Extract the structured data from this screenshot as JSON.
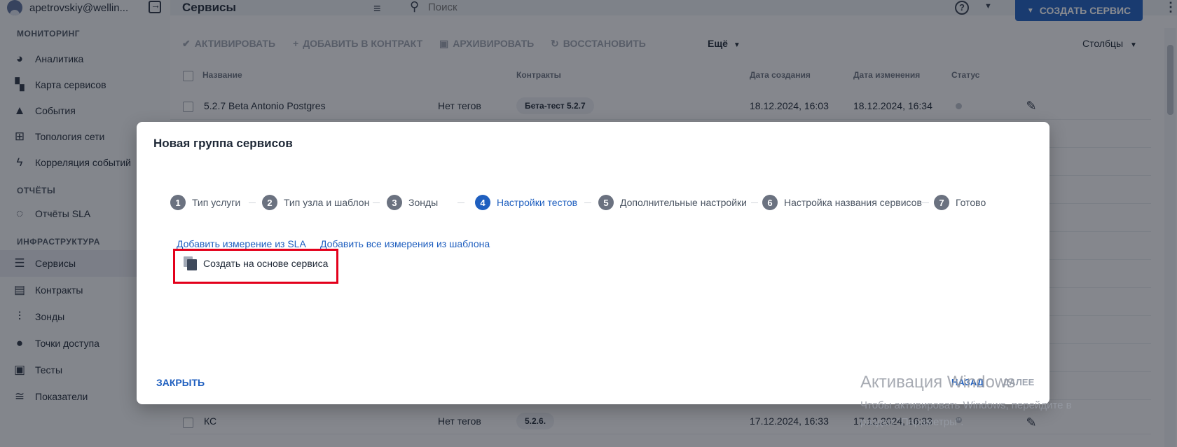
{
  "user": {
    "name": "apetrovskiy@wellin..."
  },
  "sidebar": {
    "sections": [
      {
        "title": "МОНИТОРИНГ"
      },
      {
        "title": "ОТЧЁТЫ"
      },
      {
        "title": "ИНФРАСТРУКТУРА"
      }
    ],
    "items": [
      {
        "label": "Аналитика",
        "icon": "pie-chart-icon"
      },
      {
        "label": "Карта сервисов",
        "icon": "map-icon"
      },
      {
        "label": "События",
        "icon": "warning-icon"
      },
      {
        "label": "Топология сети",
        "icon": "topology-icon"
      },
      {
        "label": "Корреляция событий",
        "icon": "bolt-icon"
      },
      {
        "label": "Отчёты SLA",
        "icon": "refresh-icon"
      },
      {
        "label": "Сервисы",
        "icon": "list-icon"
      },
      {
        "label": "Контракты",
        "icon": "document-icon"
      },
      {
        "label": "Зонды",
        "icon": "probe-icon"
      },
      {
        "label": "Точки доступа",
        "icon": "circle-icon"
      },
      {
        "label": "Тесты",
        "icon": "tests-icon"
      },
      {
        "label": "Показатели",
        "icon": "metrics-icon"
      }
    ]
  },
  "header": {
    "title": "Сервисы",
    "search_placeholder": "Поиск",
    "help": "?",
    "create_button": "СОЗДАТЬ СЕРВИС"
  },
  "toolbar": {
    "activate": "АКТИВИРОВАТЬ",
    "add_to_contract": "ДОБАВИТЬ В КОНТРАКТ",
    "archive": "АРХИВИРОВАТЬ",
    "restore": "ВОССТАНОВИТЬ",
    "more": "Ещё",
    "columns": "Столбцы"
  },
  "table": {
    "columns": [
      "Название",
      "Контракты",
      "Дата создания",
      "Дата изменения",
      "Статус"
    ],
    "rows": [
      {
        "name": "5.2.7 Beta Antonio Postgres",
        "tags": "Нет тегов",
        "contract": "Бета-тест 5.2.7",
        "created": "18.12.2024, 16:03",
        "modified": "18.12.2024, 16:34"
      },
      {
        "name": "КС",
        "tags": "Нет тегов",
        "contract": "5.2.6.",
        "created": "17.12.2024, 16:33",
        "modified": "17.12.2024, 16:33"
      }
    ]
  },
  "modal": {
    "title": "Новая группа сервисов",
    "steps": [
      {
        "num": "1",
        "label": "Тип услуги"
      },
      {
        "num": "2",
        "label": "Тип узла и шаблон"
      },
      {
        "num": "3",
        "label": "Зонды"
      },
      {
        "num": "4",
        "label": "Настройки тестов"
      },
      {
        "num": "5",
        "label": "Дополнительные настройки"
      },
      {
        "num": "6",
        "label": "Настройка названия сервисов"
      },
      {
        "num": "7",
        "label": "Готово"
      }
    ],
    "active_step": 4,
    "link_add_sla": "Добавить измерение из SLA",
    "link_add_all": "Добавить все измерения из шаблона",
    "based_on_service": "Создать на основе сервиса",
    "close": "ЗАКРЫТЬ",
    "back": "НАЗАД",
    "next": "ДАЛЕЕ"
  },
  "watermark": {
    "title": "Активация Windows",
    "line1": "Чтобы активировать Windows, перейдите в",
    "line2": "раздел \"Параметры\"."
  },
  "colors": {
    "accent": "#1f5fbf",
    "highlight": "#e3001b"
  }
}
